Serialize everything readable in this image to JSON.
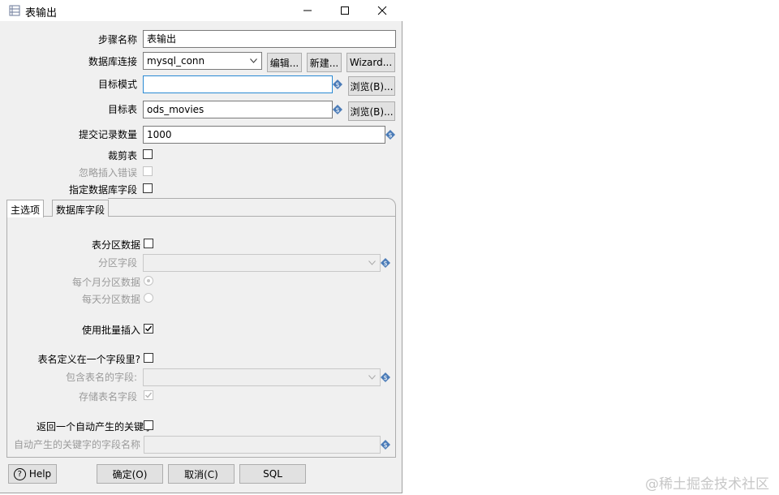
{
  "window": {
    "title": "表输出",
    "icons": {
      "app": "table-output-icon",
      "minimize": "minimize-icon",
      "maximize": "maximize-icon",
      "close": "close-icon"
    }
  },
  "form": {
    "step_name": {
      "label": "步骤名称",
      "value": "表输出"
    },
    "connection": {
      "label": "数据库连接",
      "value": "mysql_conn",
      "edit_label": "编辑...",
      "new_label": "新建...",
      "wizard_label": "Wizard..."
    },
    "target_schema": {
      "label": "目标模式",
      "value": "",
      "browse_label": "浏览(B)..."
    },
    "target_table": {
      "label": "目标表",
      "value": "ods_movies",
      "browse_label": "浏览(B)..."
    },
    "commit_size": {
      "label": "提交记录数量",
      "value": "1000"
    },
    "truncate_table": {
      "label": "裁剪表",
      "checked": false
    },
    "ignore_insert_errors": {
      "label": "忽略插入错误",
      "checked": false,
      "disabled": true
    },
    "specify_db_fields": {
      "label": "指定数据库字段",
      "checked": false
    }
  },
  "tabs": [
    {
      "label": "主选项",
      "active": true
    },
    {
      "label": "数据库字段",
      "active": false
    }
  ],
  "main_options": {
    "partition_data": {
      "label": "表分区数据",
      "checked": false
    },
    "partition_field": {
      "label": "分区字段",
      "value": ""
    },
    "partition_monthly": {
      "label": "每个月分区数据",
      "selected": true
    },
    "partition_daily": {
      "label": "每天分区数据",
      "selected": false
    },
    "use_batch": {
      "label": "使用批量插入",
      "checked": true
    },
    "tablename_in_field": {
      "label": "表名定义在一个字段里?",
      "checked": false
    },
    "tablename_field": {
      "label": "包含表名的字段:",
      "value": ""
    },
    "store_tablename": {
      "label": "存储表名字段",
      "checked": true
    },
    "return_generated_key": {
      "label": "返回一个自动产生的关键字",
      "checked": false
    },
    "generated_key_field": {
      "label": "自动产生的关键字的字段名称",
      "value": ""
    }
  },
  "footer": {
    "help_label": "Help",
    "ok_label": "确定(O)",
    "cancel_label": "取消(C)",
    "sql_label": "SQL"
  },
  "watermark": "@稀土掘金技术社区",
  "colors": {
    "window_bg": "#f0f0f0",
    "focus_border": "#2a8ad4",
    "variable_icon": "#4a7bb7",
    "disabled_text": "#9a9a9a"
  }
}
